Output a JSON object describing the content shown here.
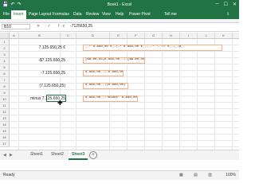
{
  "window": {
    "title": "Book1 - Excel",
    "controls": {
      "minimize": "─",
      "maximize": "☐",
      "close": "✕"
    }
  },
  "quick_access": {
    "save": "💾",
    "undo": "↶",
    "redo": "↷"
  },
  "ribbon_tabs": {
    "file": "File",
    "insert": "Insert",
    "page_layout": "Page Layout",
    "formulas": "Formulas",
    "data": "Data",
    "review": "Review",
    "view": "View",
    "help": "Help",
    "power_pivot": "Power Pivot",
    "tell_me": "Tell me",
    "share": "⇪"
  },
  "formula_bar": {
    "name_box": "B10",
    "icons": "✕ ✓ fx",
    "value": "-7125650,25"
  },
  "columns": [
    "A",
    "B",
    "C",
    "D",
    "E",
    "F",
    "G",
    "H",
    "I",
    "J",
    "K",
    "L"
  ],
  "rows": [
    "1",
    "2",
    "3",
    "4",
    "5",
    "6",
    "7",
    "8",
    "9",
    "10",
    "11",
    "12",
    "13",
    "14",
    "15",
    "16",
    "17"
  ],
  "cells": {
    "b2": "7.125.650,25 €",
    "b4": "-$7.125.650,25",
    "b6": "-7.125.650,25",
    "b8": "(7.125.650,25)",
    "b10": "minus 7.125.650,25"
  },
  "formats": {
    "d2": "_-* #.##0,00 €_-;-* #.##0,00 €_-;_-* \"-\"?? €_-;_-@_-",
    "d4": "[$$-en-US]#.##0,00_-;-[$$-en-US]#.##0,00",
    "d6": "#.##0,00_-;-#.##0,00",
    "d8": "#.##0,00_-;(#.##0,00)",
    "d10": "#.##0,00_-;\"minus\" #.##0,00"
  },
  "sheets": [
    "Sheet1",
    "Sheet2",
    "Sheet3"
  ],
  "active_sheet": "Sheet3",
  "status": {
    "ready": "Ready",
    "zoom": "100%"
  },
  "colors": {
    "accent": "#217346",
    "format_border": "#f4b183"
  }
}
